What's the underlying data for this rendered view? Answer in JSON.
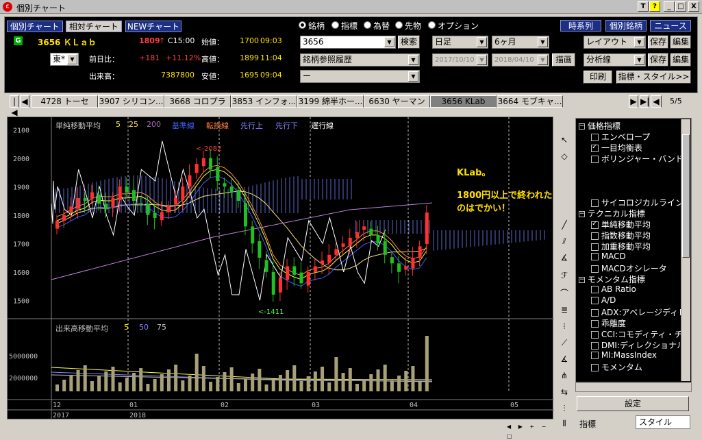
{
  "window": {
    "title": "個別チャート",
    "sys_buttons": [
      "T",
      "?",
      "_",
      "□",
      "X"
    ]
  },
  "nav": {
    "buttons": [
      "個別チャート",
      "相対チャート",
      "NEWチャート"
    ],
    "right_buttons": [
      "時系列",
      "個別銘柄",
      "ニュース"
    ]
  },
  "quote": {
    "badge": "G",
    "code_name": "3656 ＫＬａｂ",
    "price": "1809",
    "price_arrow": "↑",
    "time": "C15:00",
    "open_label": "始値：",
    "open_value": "1700",
    "open_time": "09:03",
    "market": "東*",
    "change_label": "前日比：",
    "change_value": "+181",
    "change_pct": "+11.12%",
    "high_label": "高値：",
    "high_value": "1899",
    "high_time": "11:04",
    "volume_label": "出来高：",
    "volume_value": "7387800",
    "low_label": "安値：",
    "low_value": "1695",
    "low_time": "09:04"
  },
  "asset_types": [
    "銘柄",
    "指標",
    "為替",
    "先物",
    "オプション"
  ],
  "search": {
    "code": "3656",
    "button": "検索",
    "history": "銘柄参照履歴",
    "third": "ー"
  },
  "period": {
    "interval": "日足",
    "range": "6ヶ月",
    "from": "2017/10/10",
    "to": "2018/04/10",
    "draw": "描画"
  },
  "layout": {
    "layout_label": "レイアウト",
    "analysis_label": "分析線",
    "save": "保存",
    "edit": "編集",
    "print": "印刷",
    "indicator_style": "指標・スタイル>>"
  },
  "tabs": [
    "4728 トーセ",
    "3907 シリコン...",
    "3668 コロプラ",
    "3853 インフォ...",
    "3199 綿半ホー...",
    "6630 ヤーマン",
    "3656 KLab",
    "3664 モブキャ..."
  ],
  "tab_page": "5/5",
  "chart": {
    "legend_ma": "単純移動平均",
    "ma_periods": [
      "5",
      "25",
      "200"
    ],
    "ichimoku": [
      "基準線",
      "転換線",
      "先行上",
      "先行下",
      "遅行線"
    ],
    "legend_vol": "出来高移動平均",
    "vol_periods": [
      "5",
      "50",
      "75"
    ],
    "y_ticks": [
      "2100",
      "2000",
      "1900",
      "1800",
      "1700",
      "1600",
      "1500"
    ],
    "vol_ticks": [
      "5000000",
      "2000000"
    ],
    "x_months": [
      "12",
      "01",
      "02",
      "03",
      "04",
      "05"
    ],
    "x_years": [
      "2017",
      "2018"
    ],
    "annot_high": "<-2082",
    "annot_low": "<-1411",
    "overlay_line1": "KLab。",
    "overlay_line2": "1800円以上で終われたのはでかい！"
  },
  "chart_data": {
    "type": "candlestick",
    "title": "",
    "ylim": [
      1450,
      2120
    ],
    "x_month_labels": [
      "12",
      "01",
      "02",
      "03",
      "04",
      "05"
    ],
    "close_approx": [
      1780,
      1800,
      1830,
      1860,
      1850,
      1880,
      1840,
      1820,
      1860,
      1900,
      1880,
      1850,
      1840,
      1800,
      1790,
      1810,
      1830,
      1860,
      1900,
      1940,
      1980,
      2000,
      1960,
      1920,
      1900,
      1880,
      1850,
      1760,
      1700,
      1650,
      1600,
      1520,
      1580,
      1620,
      1590,
      1560,
      1600,
      1620,
      1640,
      1660,
      1680,
      1700,
      1720,
      1740,
      1760,
      1730,
      1700,
      1660,
      1630,
      1600,
      1620,
      1650,
      1690,
      1809
    ],
    "high": 2082,
    "low": 1411,
    "last_close": 1809,
    "volume_ticks": [
      5000000,
      2000000
    ]
  },
  "tree": {
    "items": [
      {
        "type": "group",
        "label": "価格指標"
      },
      {
        "type": "item",
        "label": "エンベロープ",
        "checked": false
      },
      {
        "type": "item",
        "label": "一目均衡表",
        "checked": true
      },
      {
        "type": "item",
        "label": "ボリンジャー・バンド",
        "checked": false
      },
      {
        "type": "item",
        "label": "サイコロジカルライン",
        "checked": false
      },
      {
        "type": "group",
        "label": "テクニカル指標"
      },
      {
        "type": "item",
        "label": "単純移動平均",
        "checked": true
      },
      {
        "type": "item",
        "label": "指数移動平均",
        "checked": false
      },
      {
        "type": "item",
        "label": "加重移動平均",
        "checked": false
      },
      {
        "type": "item",
        "label": "MACD",
        "checked": false
      },
      {
        "type": "item",
        "label": "MACDオシレータ",
        "checked": false
      },
      {
        "type": "group",
        "label": "モメンタム指標"
      },
      {
        "type": "item",
        "label": "AB Ratio",
        "checked": false
      },
      {
        "type": "item",
        "label": "A/D",
        "checked": false
      },
      {
        "type": "item",
        "label": "ADX:アベレージディレ",
        "checked": false
      },
      {
        "type": "item",
        "label": "乖離度",
        "checked": false
      },
      {
        "type": "item",
        "label": "CCI:コモディティ・チャ",
        "checked": false
      },
      {
        "type": "item",
        "label": "DMI:ディレクショナル",
        "checked": false
      },
      {
        "type": "item",
        "label": "MI:MassIndex",
        "checked": false
      },
      {
        "type": "item",
        "label": "モメンタム",
        "checked": false
      }
    ],
    "settings_button": "設定",
    "bottom_tabs": [
      "指標",
      "スタイル"
    ]
  }
}
